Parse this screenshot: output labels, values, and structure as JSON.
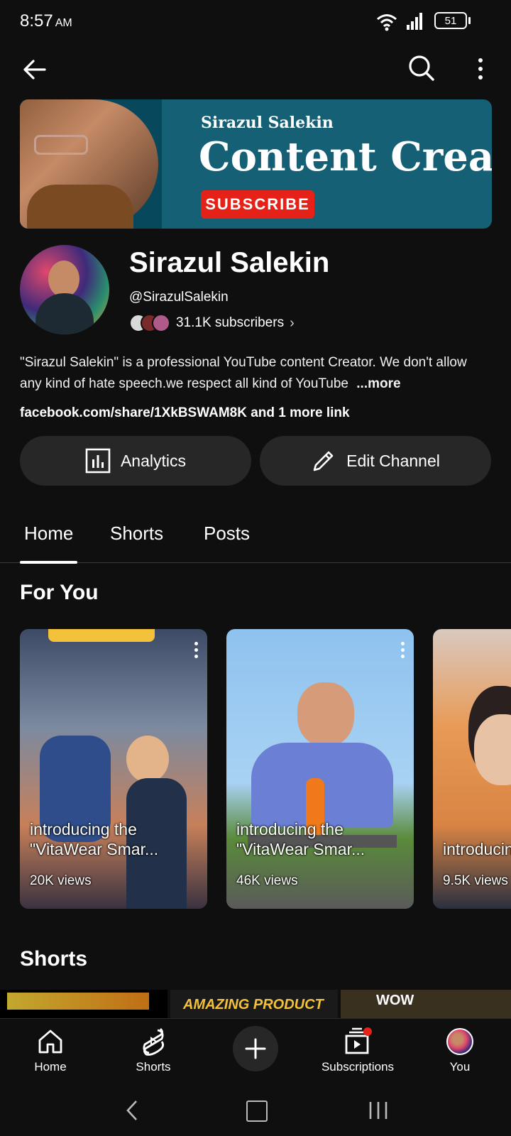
{
  "status_bar": {
    "time": "8:57",
    "ampm": "AM",
    "battery": "51"
  },
  "banner": {
    "line1": "Sirazul Salekin",
    "line2": "Content Creat",
    "cta": "SUBSCRIBE"
  },
  "channel": {
    "name": "Sirazul Salekin",
    "handle": "@SirazulSalekin",
    "subscribers": "31.1K subscribers",
    "description": "\"Sirazul Salekin\" is a professional YouTube content Creator. We don't allow any kind of hate speech.we respect all kind of YouTube",
    "more": "...more",
    "links": "facebook.com/share/1XkBSWAM8K and 1 more link"
  },
  "actions": {
    "analytics": "Analytics",
    "edit": "Edit Channel"
  },
  "tabs": [
    {
      "label": "Home",
      "active": true
    },
    {
      "label": "Shorts",
      "active": false
    },
    {
      "label": "Posts",
      "active": false
    }
  ],
  "for_you": {
    "title": "For You",
    "cards": [
      {
        "title": "introducing the \"VitaWear Smar...",
        "views": "20K views"
      },
      {
        "title": "introducing the \"VitaWear Smar...",
        "views": "46K views"
      },
      {
        "title": "introducing the \"VitaW",
        "views": "9.5K views"
      }
    ]
  },
  "shorts_section": {
    "title": "Shorts",
    "strip": [
      "AMAZING PRODUCT",
      "WOW"
    ]
  },
  "bottom_nav": {
    "home": "Home",
    "shorts": "Shorts",
    "subscriptions": "Subscriptions",
    "you": "You"
  },
  "colors": {
    "accent_red": "#e62117",
    "banner_teal": "#166076",
    "button_bg": "#272727"
  }
}
